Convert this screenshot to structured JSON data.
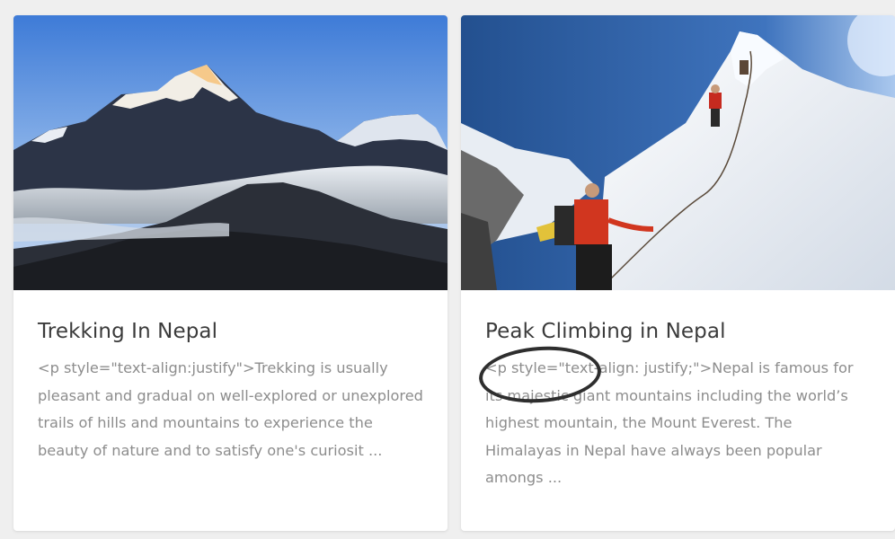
{
  "cards": [
    {
      "image_alt": "snowy mountain range above clouds",
      "title": "Trekking In Nepal",
      "excerpt": "<p style=\"text-align:justify\">Trekking is usually pleasant and gradual on well-explored or unexplored trails of hills and mountains to experience the beauty of nature and to satisfy one's curiosit ..."
    },
    {
      "image_alt": "climbers ascending a snowy peak with ropes",
      "title": "Peak Climbing in Nepal",
      "excerpt": "<p style=\"text-align: justify;\">Nepal is famous for its majestic giant mountains including the world’s highest mountain, the Mount Everest. The Himalayas in Nepal have always been popular amongs ..."
    }
  ]
}
